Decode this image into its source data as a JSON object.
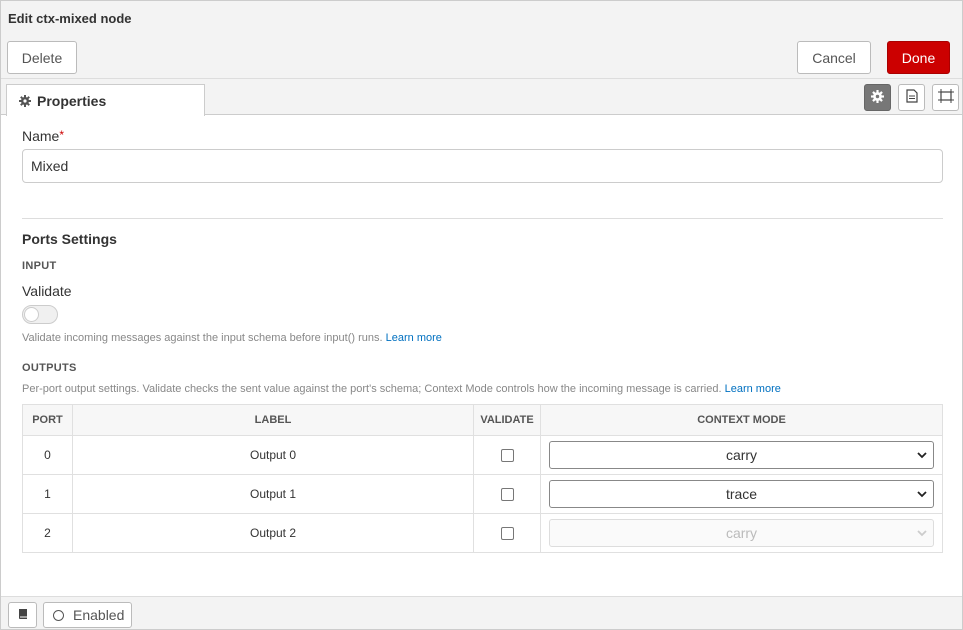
{
  "window": {
    "title": "Edit ctx-mixed node"
  },
  "toolbar": {
    "delete_label": "Delete",
    "cancel_label": "Cancel",
    "done_label": "Done"
  },
  "tabs": [
    {
      "label": "Properties",
      "icon": "gear-icon"
    }
  ],
  "tab_icons": [
    "gear-icon",
    "document-icon",
    "frame-icon"
  ],
  "form": {
    "name_label": "Name",
    "name_required_mark": "*",
    "name_value": "Mixed",
    "ports_heading": "Ports Settings",
    "input_heading": "INPUT",
    "validate_label": "Validate",
    "validate_help": "Validate incoming messages against the input schema before input() runs.",
    "learn_more": "Learn more",
    "outputs_heading": "OUTPUTS",
    "outputs_help": "Per-port output settings. Validate checks the sent value against the port's schema; Context Mode controls how the incoming message is carried."
  },
  "table": {
    "headers": [
      "PORT",
      "LABEL",
      "VALIDATE",
      "CONTEXT MODE"
    ],
    "rows": [
      {
        "port": "0",
        "label": "Output 0",
        "mode": "carry"
      },
      {
        "port": "1",
        "label": "Output 1",
        "mode": "trace"
      },
      {
        "port": "2",
        "label": "Output 2",
        "mode": "carry"
      }
    ]
  },
  "footer": {
    "enabled_label": "Enabled"
  }
}
